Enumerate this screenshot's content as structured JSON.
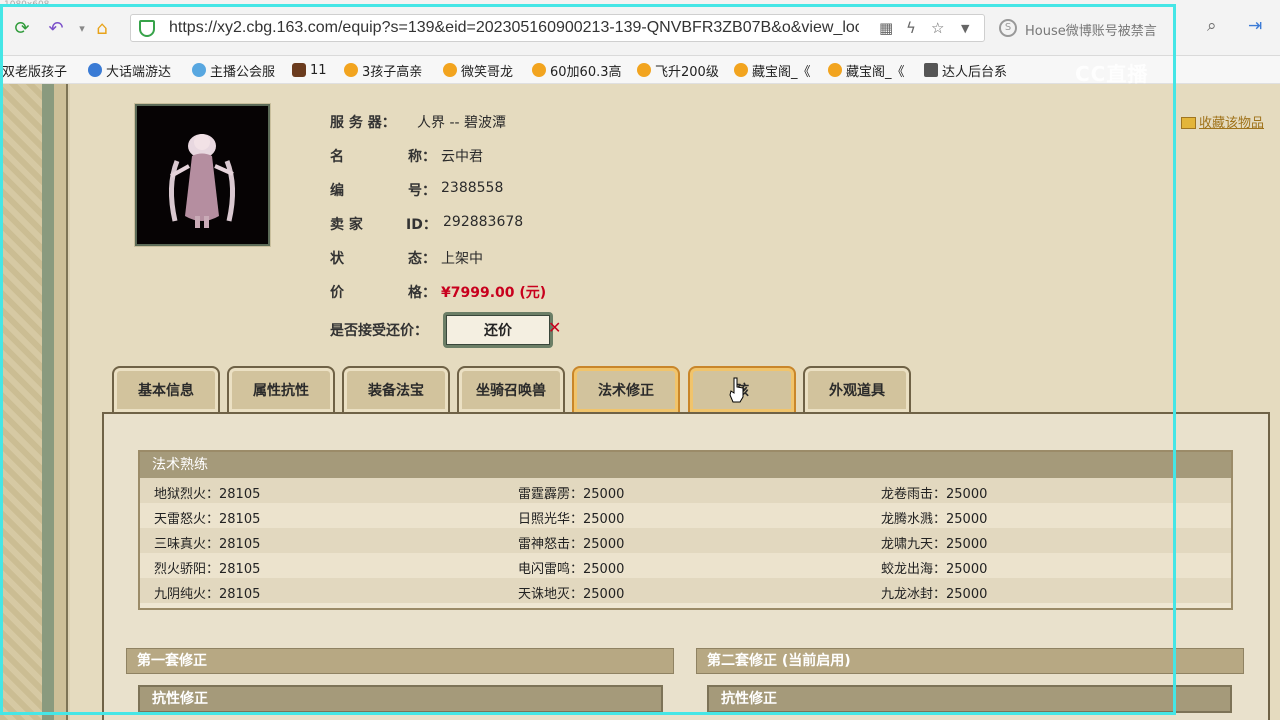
{
  "browser": {
    "resolution_label": "1080x608",
    "url": "https://xy2.cbg.163.com/equip?s=139&eid=202305160900213-139-QNVBFR3ZB07B&o&view_loc",
    "search_text": "House微博账号被禁言"
  },
  "bookmarks": [
    {
      "label": "双老版孩子"
    },
    {
      "label": "大话端游达"
    },
    {
      "label": "主播公会服"
    },
    {
      "label": "11"
    },
    {
      "label": "3孩子高亲"
    },
    {
      "label": "微笑哥龙"
    },
    {
      "label": "60加60.3高"
    },
    {
      "label": "飞升200级"
    },
    {
      "label": "藏宝阁_《"
    },
    {
      "label": "藏宝阁_《"
    },
    {
      "label": "达人后台系"
    }
  ],
  "watermark": "CC直播",
  "item": {
    "server_label": "服 务 器：",
    "server_value": "人界 -- 碧波潭",
    "name_label1": "名",
    "name_label2": "称：",
    "name_value": "云中君",
    "id_label1": "编",
    "id_label2": "号：",
    "id_value": "2388558",
    "seller_label1": "卖 家",
    "seller_label2": "ID：",
    "seller_value": "292883678",
    "status_label1": "状",
    "status_label2": "态：",
    "status_value": "上架中",
    "price_label1": "价",
    "price_label2": "格：",
    "price_value": "¥7999.00 (元)",
    "bargain_label": "是否接受还价：",
    "bargain_button": "还价",
    "favorite_link": "收藏该物品"
  },
  "tabs": [
    {
      "label": "基本信息"
    },
    {
      "label": "属性抗性"
    },
    {
      "label": "装备法宝"
    },
    {
      "label": "坐骑召唤兽"
    },
    {
      "label": "法术修正"
    },
    {
      "label": "孩"
    },
    {
      "label": "外观道具"
    }
  ],
  "spell_section": {
    "title": "法术熟练",
    "rows": [
      [
        "地狱烈火：28105",
        "雷霆霹雳：25000",
        "龙卷雨击：25000"
      ],
      [
        "天雷怒火：28105",
        "日照光华：25000",
        "龙腾水溅：25000"
      ],
      [
        "三味真火：28105",
        "雷神怒击：25000",
        "龙啸九天：25000"
      ],
      [
        "烈火骄阳：28105",
        "电闪雷鸣：25000",
        "蛟龙出海：25000"
      ],
      [
        "九阴纯火：28105",
        "天诛地灭：25000",
        "九龙冰封：25000"
      ]
    ]
  },
  "correction": {
    "set1_title": "第一套修正",
    "set2_title": "第二套修正 (当前启用)",
    "set1_sub": "抗性修正",
    "set2_sub": "抗性修正"
  }
}
